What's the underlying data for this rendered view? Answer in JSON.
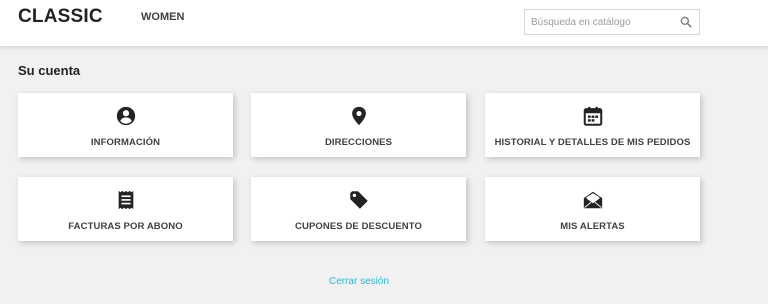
{
  "header": {
    "logo": "CLASSIC",
    "nav": [
      {
        "label": "WOMEN"
      }
    ],
    "search": {
      "placeholder": "Búsqueda en catálogo",
      "value": "",
      "icon": "search-icon"
    }
  },
  "main": {
    "title": "Su cuenta",
    "cards": [
      {
        "label": "INFORMACIÓN",
        "icon": "account-circle-icon"
      },
      {
        "label": "DIRECCIONES",
        "icon": "location-pin-icon"
      },
      {
        "label": "HISTORIAL Y DETALLES DE MIS PEDIDOS",
        "icon": "calendar-icon"
      },
      {
        "label": "FACTURAS POR ABONO",
        "icon": "receipt-icon"
      },
      {
        "label": "CUPONES DE DESCUENTO",
        "icon": "tag-icon"
      },
      {
        "label": "MIS ALERTAS",
        "icon": "open-envelope-icon"
      }
    ],
    "logout": "Cerrar sesión"
  },
  "colors": {
    "accent_link": "#24b9d7",
    "text": "#232323",
    "background": "#f1f1f1"
  }
}
